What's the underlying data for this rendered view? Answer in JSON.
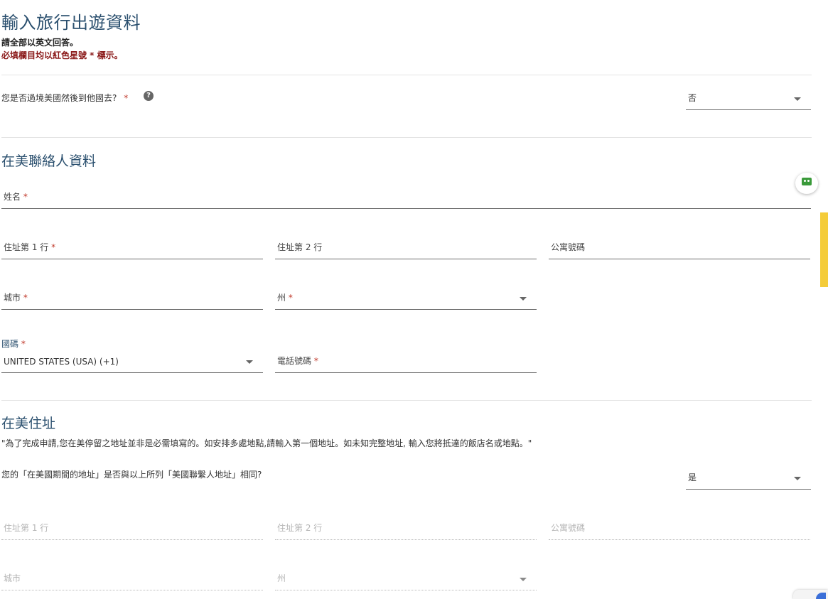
{
  "page": {
    "title": "輸入旅行出遊資料",
    "note_english": "請全部以英文回答。",
    "note_required": "必填欄目均以紅色星號 * 標示。"
  },
  "transit": {
    "question": "您是否過境美國然後到他國去?",
    "required_mark": "*",
    "help_icon": "?",
    "value": "否"
  },
  "contact": {
    "section_title": "在美聯絡人資料",
    "name_label": "姓名",
    "address1_label": "住址第 1 行",
    "address2_label": "住址第 2 行",
    "apt_label": "公寓號碼",
    "city_label": "城市",
    "state_label": "州",
    "country_code_label": "國碼",
    "country_code_value": "UNITED STATES (USA) (+1)",
    "phone_label": "電話號碼",
    "required_mark": "*"
  },
  "us_address": {
    "section_title": "在美住址",
    "description": "\"為了完成申請,您在美停留之地址並非是必需填寫的。如安排多處地點,請輸入第一個地址。如未知完整地址, 輸入您將抵達的飯店名或地點。\"",
    "same_question": "您的「在美國期間的地址」是否與以上所列「美國聯繫人地址」相同?",
    "same_value": "是",
    "address1_label": "住址第 1 行",
    "address2_label": "住址第 2 行",
    "apt_label": "公寓號碼",
    "city_label": "城市",
    "state_label": "州"
  },
  "colors": {
    "heading": "#2a4f6e",
    "required": "#c0392b",
    "note_required": "#8b1a1a",
    "side_tab": "#f4cc3a",
    "chat_icon": "#3a9a3a"
  },
  "icons": {
    "help": "question-circle-icon",
    "dropdown": "caret-down-icon",
    "chat": "chatbot-icon"
  }
}
